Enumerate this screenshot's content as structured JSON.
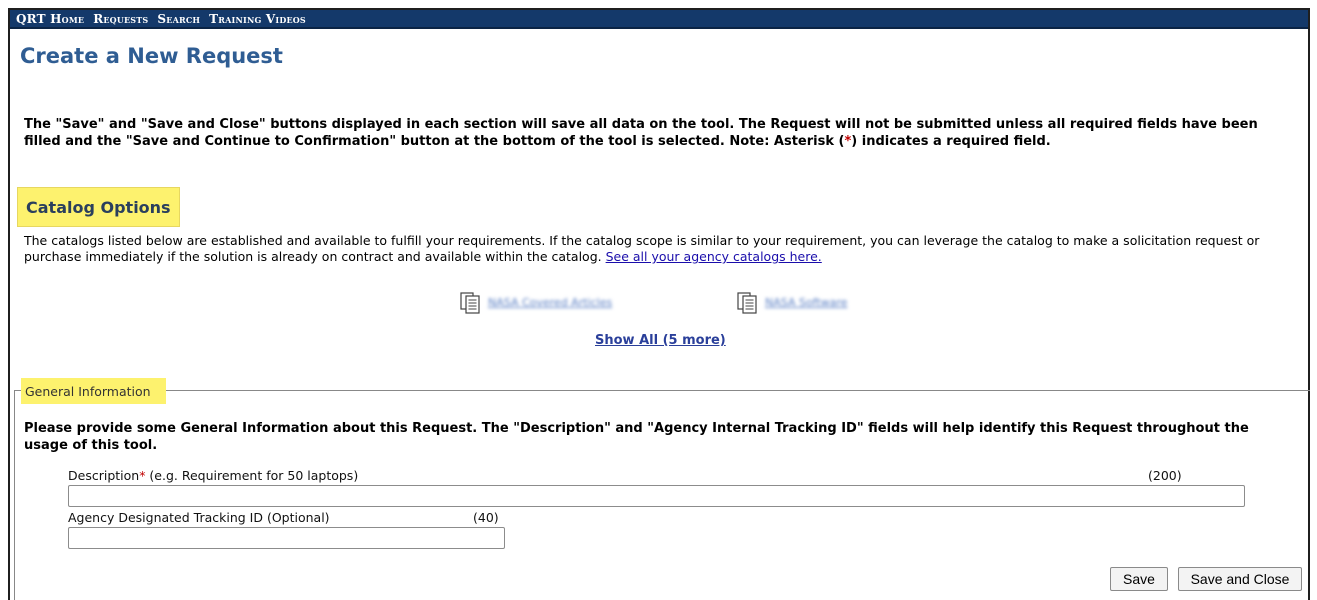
{
  "nav": {
    "items": [
      "QRT Home",
      "Requests",
      "Search",
      "Training Videos"
    ]
  },
  "page": {
    "title": "Create a New Request"
  },
  "intro": {
    "part1": "The \"Save\" and \"Save and Close\" buttons displayed in each section will save all data on the tool. The Request will not be submitted unless all required fields have been filled and the \"Save and Continue to Confirmation\" button at the bottom of the tool is selected. Note: Asterisk (",
    "asterisk": "*",
    "part2": ") indicates a required field."
  },
  "catalog": {
    "heading": "Catalog Options",
    "text": "The catalogs listed below are established and available to fulfill your requirements. If the catalog scope is similar to your requirement, you can leverage the catalog to make a solicitation request or purchase immediately if the solution is already on contract and available within the catalog. ",
    "link_text": "See all your agency catalogs here.",
    "items": [
      {
        "label": "NASA Covered Articles",
        "icon": "document-icon"
      },
      {
        "label": "NASA Software",
        "icon": "document-icon"
      }
    ],
    "show_all": "Show All (5 more)"
  },
  "general": {
    "legend": "General Information",
    "text": "Please provide some General Information about this Request. The \"Description\" and \"Agency Internal Tracking ID\" fields will help identify this Request throughout the usage of this tool.",
    "description": {
      "label": "Description",
      "asterisk": "*",
      "hint": " (e.g. Requirement for 50 laptops)",
      "counter": "(200)",
      "value": ""
    },
    "tracking": {
      "label": "Agency Designated Tracking ID (Optional)",
      "counter": "(40)",
      "value": ""
    }
  },
  "buttons": {
    "save": "Save",
    "save_close": "Save and Close"
  },
  "colors": {
    "nav_bg": "#14396a",
    "title": "#2f5d93",
    "highlight": "#fdf26e",
    "required": "#c00000"
  }
}
